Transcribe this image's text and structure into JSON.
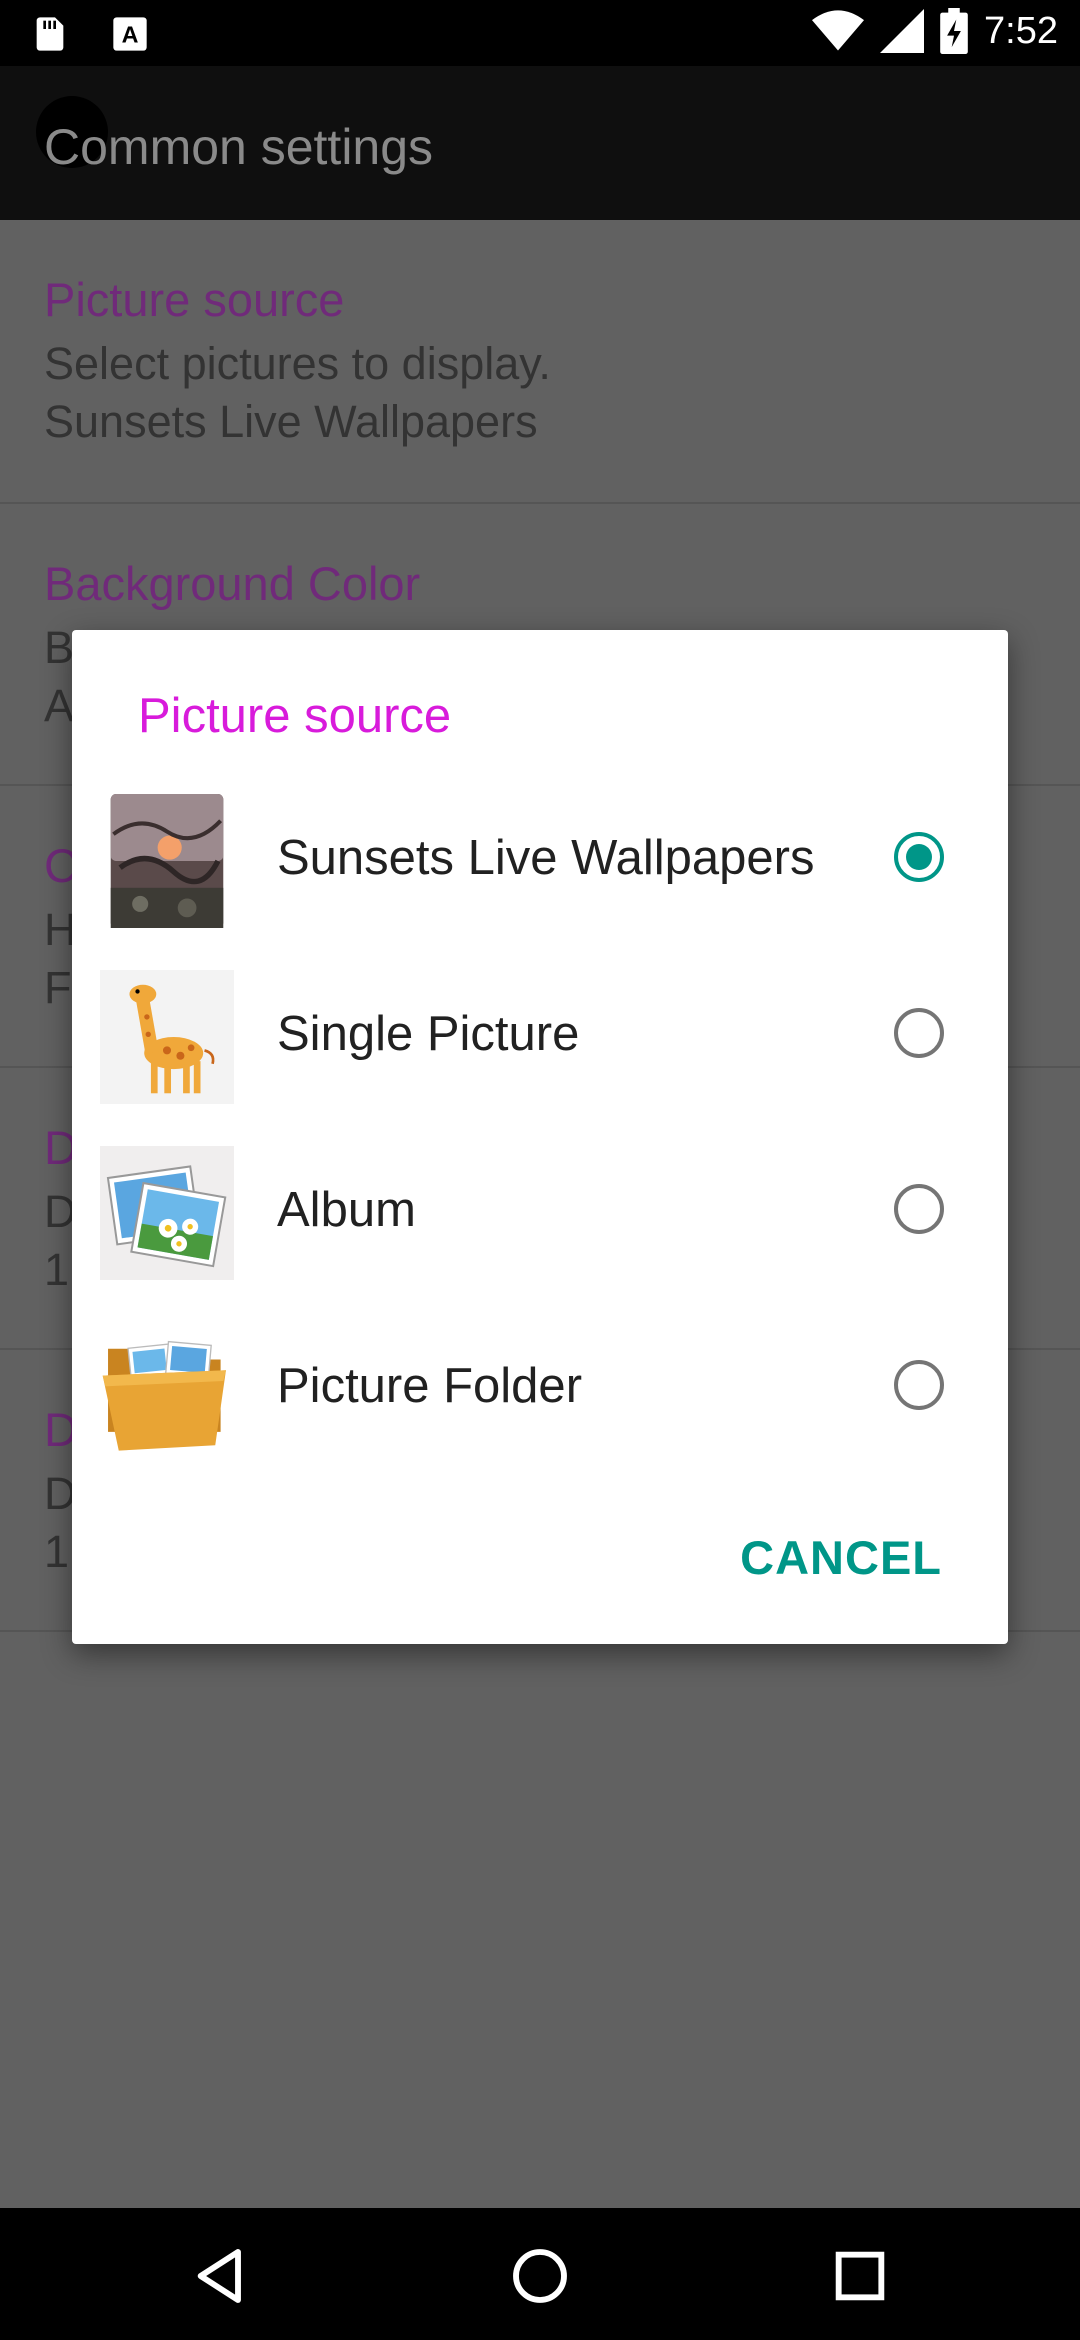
{
  "status_bar": {
    "time": "7:52",
    "icons": [
      "sd-card-icon",
      "a-notification-icon",
      "wifi-icon",
      "cell-signal-icon",
      "battery-charging-icon"
    ]
  },
  "app_bar": {
    "title": "Common settings"
  },
  "settings": [
    {
      "title": "Picture source",
      "line1": "Select pictures to display.",
      "line2": "Sunsets Live Wallpapers"
    },
    {
      "title": "Background Color",
      "line1": "B",
      "line2": "A"
    },
    {
      "title": "C",
      "line1": "H",
      "line2": "F"
    },
    {
      "title": "D",
      "line1": "D",
      "line2": "1"
    },
    {
      "title": "D",
      "line1": "D",
      "line2": "1"
    }
  ],
  "dialog": {
    "title": "Picture source",
    "options": [
      {
        "label": "Sunsets Live Wallpapers",
        "selected": true,
        "thumbnail": "sunset-thumbnail"
      },
      {
        "label": "Single Picture",
        "selected": false,
        "thumbnail": "giraffe-thumbnail"
      },
      {
        "label": "Album",
        "selected": false,
        "thumbnail": "album-photos-icon"
      },
      {
        "label": "Picture Folder",
        "selected": false,
        "thumbnail": "folder-icon"
      }
    ],
    "cancel_label": "CANCEL"
  },
  "colors": {
    "accent": "#009688",
    "dialog_title": "#d81bdb",
    "setting_title": "#702a7a"
  },
  "nav_bar": {
    "buttons": [
      "back-icon",
      "home-icon",
      "recents-icon"
    ]
  }
}
